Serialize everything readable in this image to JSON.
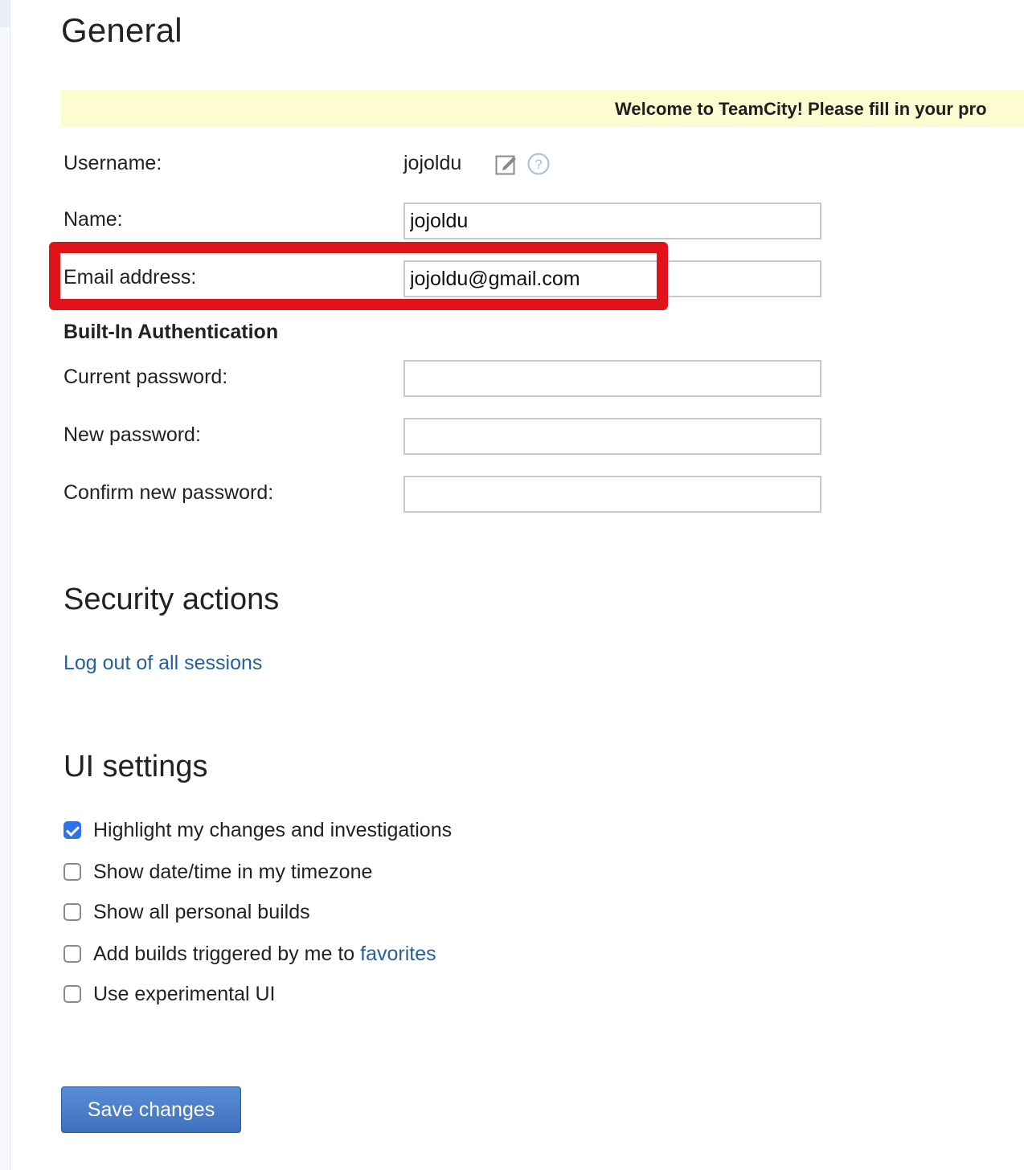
{
  "general": {
    "title": "General"
  },
  "banner": {
    "text": "Welcome to TeamCity! Please fill in your pro"
  },
  "profile": {
    "username_label": "Username:",
    "username_value": "jojoldu",
    "name_label": "Name:",
    "name_value": "jojoldu",
    "email_label": "Email address:",
    "email_value": "jojoldu@gmail.com"
  },
  "auth": {
    "heading": "Built-In Authentication",
    "current_password_label": "Current password:",
    "new_password_label": "New password:",
    "confirm_password_label": "Confirm new password:"
  },
  "security": {
    "title": "Security actions",
    "logout_link": "Log out of all sessions"
  },
  "ui_settings": {
    "title": "UI settings",
    "options": [
      {
        "label": "Highlight my changes and investigations",
        "checked": true
      },
      {
        "label": "Show date/time in my timezone",
        "checked": false
      },
      {
        "label": "Show all personal builds",
        "checked": false
      },
      {
        "label": "Add builds triggered by me to ",
        "link": "favorites",
        "checked": false
      },
      {
        "label": "Use experimental UI",
        "checked": false
      }
    ]
  },
  "actions": {
    "save_label": "Save changes"
  },
  "icons": {
    "edit": "edit-icon",
    "help": "help-icon"
  },
  "colors": {
    "link": "#25609d",
    "highlight": "#e0121b",
    "banner": "#fdfbd0",
    "checkbox_checked": "#2e73e8",
    "button": "#4a7cc9"
  }
}
